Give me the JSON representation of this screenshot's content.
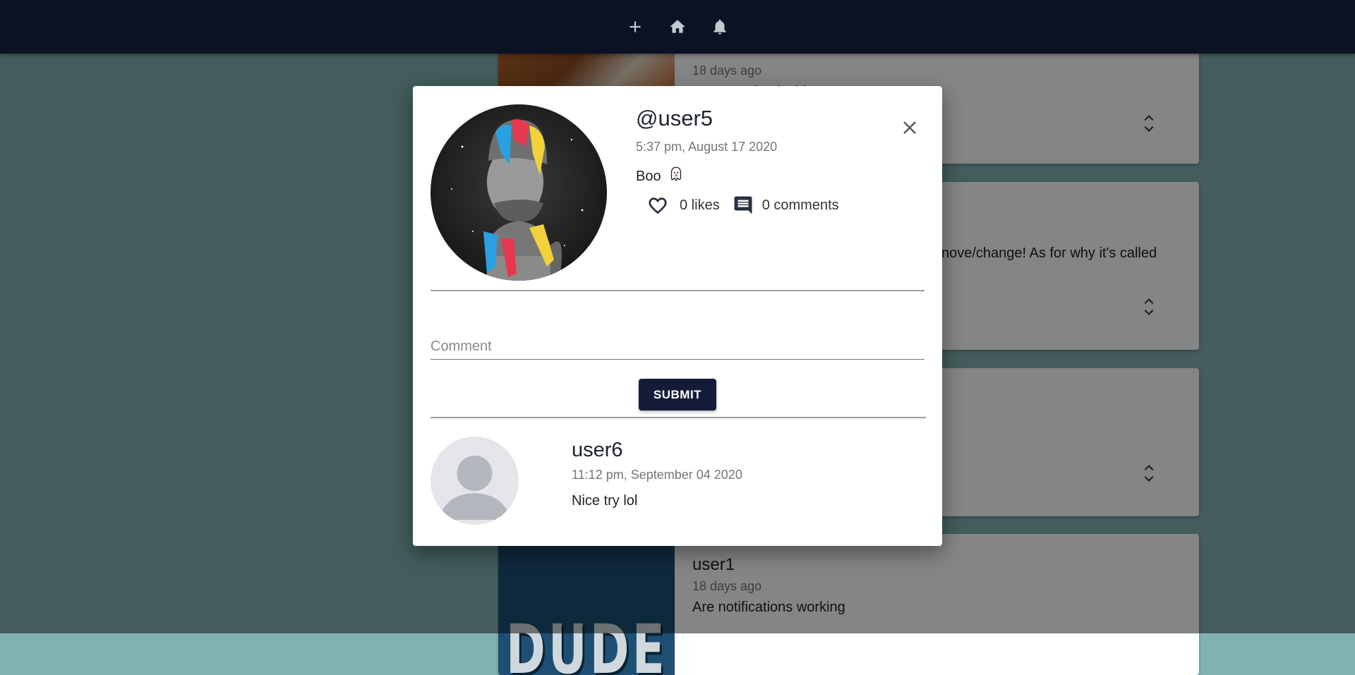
{
  "topbar": {
    "icons": [
      "add-icon",
      "home-icon",
      "notifications-icon"
    ],
    "background": "#0b1224"
  },
  "feed": {
    "post1": {
      "time": "18 days ago",
      "text": "How's ... that is this?"
    },
    "post2": {
      "text": "nove/change! As for why it's called"
    },
    "post4": {
      "user": "user1",
      "time": "18 days ago",
      "text": "Are notifications working",
      "thumb_text": "DUDE"
    }
  },
  "modal": {
    "username": "@user5",
    "timestamp": "5:37 pm, August 17 2020",
    "body": "Boo",
    "body_emoji": "ghost-icon",
    "likes": "0 likes",
    "comments": "0 comments",
    "comment_placeholder": "Comment",
    "submit_label": "SUBMIT",
    "comment_list": [
      {
        "user": "user6",
        "time": "11:12 pm, September 04 2020",
        "text": "Nice try lol"
      }
    ]
  },
  "colors": {
    "accent": "#141c38",
    "page_background": "#7fb2b1"
  }
}
